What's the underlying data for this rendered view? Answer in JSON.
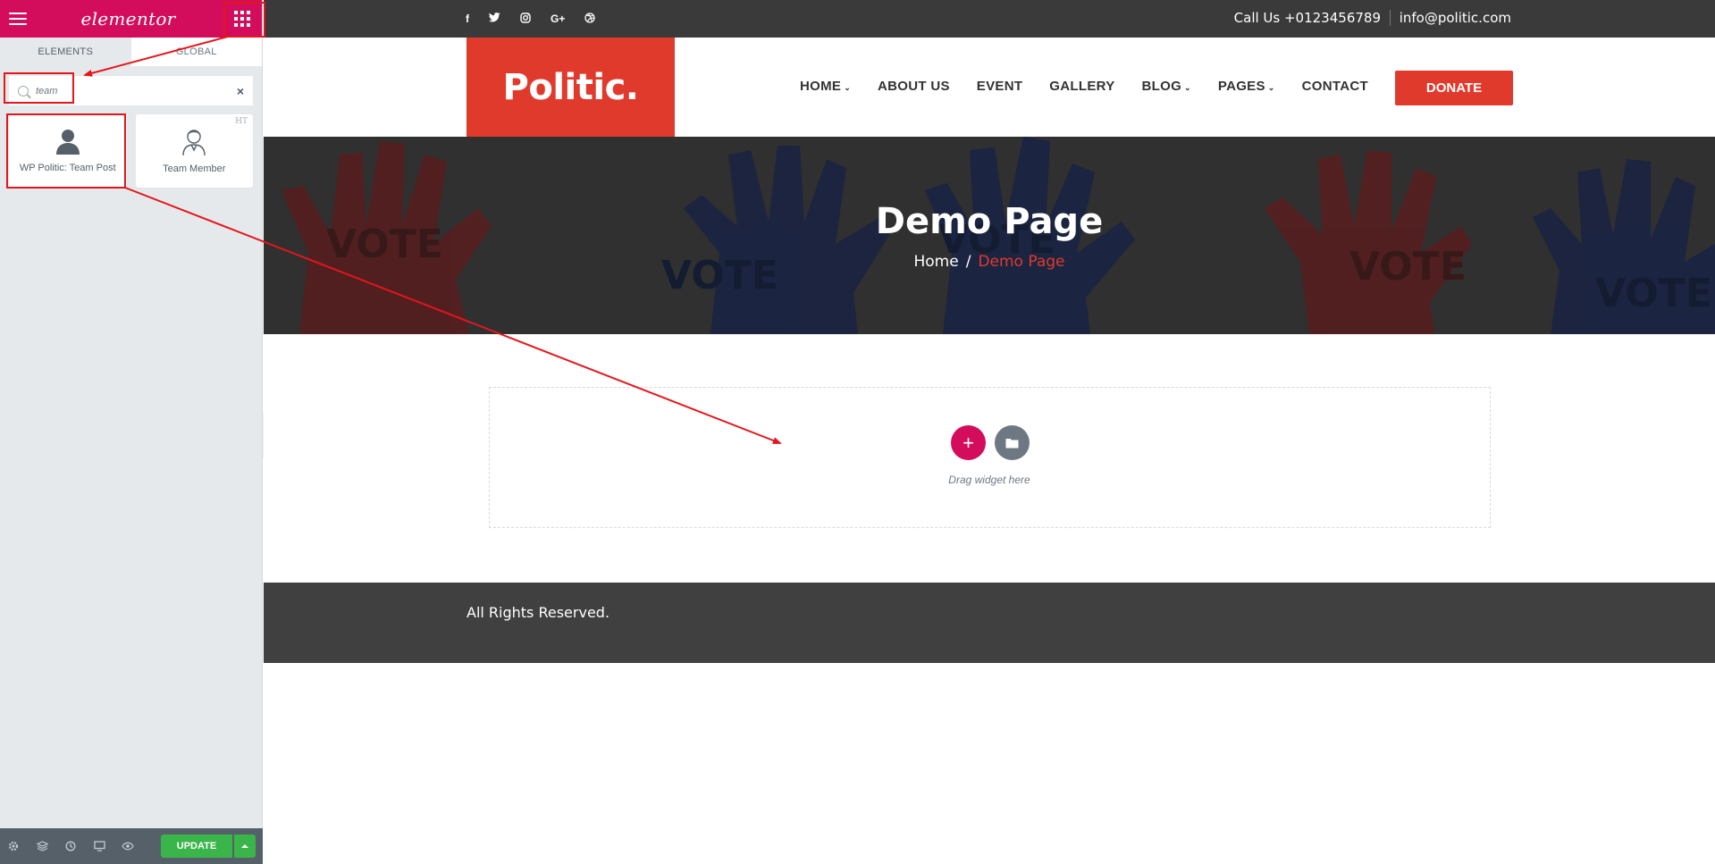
{
  "panel": {
    "brand": "elementor",
    "tabs": [
      {
        "label": "ELEMENTS"
      },
      {
        "label": "GLOBAL"
      }
    ],
    "search": {
      "value": "team"
    },
    "widgets": [
      {
        "label": "WP Politic: Team Post",
        "icon": "person-icon"
      },
      {
        "label": "Team Member",
        "icon": "team-member-icon",
        "badge": "HT"
      }
    ],
    "footer": {
      "update_label": "UPDATE"
    }
  },
  "site": {
    "social_icons": [
      "facebook-icon",
      "twitter-icon",
      "instagram-icon",
      "google-plus-icon",
      "dribbble-icon"
    ],
    "call": "Call Us +0123456789",
    "email": "info@politic.com",
    "logo": "Politic.",
    "nav": [
      {
        "label": "HOME",
        "dropdown": true
      },
      {
        "label": "ABOUT US",
        "dropdown": false
      },
      {
        "label": "EVENT",
        "dropdown": false
      },
      {
        "label": "GALLERY",
        "dropdown": false
      },
      {
        "label": "BLOG",
        "dropdown": true
      },
      {
        "label": "PAGES",
        "dropdown": true
      },
      {
        "label": "CONTACT",
        "dropdown": false
      }
    ],
    "donate": "DONATE",
    "hero": {
      "title": "Demo Page",
      "crumb_home": "Home",
      "crumb_sep": "/",
      "crumb_current": "Demo Page",
      "vote_text": "VOTE"
    },
    "dropzone": {
      "text": "Drag widget here",
      "add": "+"
    },
    "footer": "All Rights Reserved."
  },
  "colors": {
    "elementor": "#d30c5c",
    "brand_red": "#e03a2d",
    "update_green": "#39b54a",
    "annotation": "#e3161b"
  }
}
